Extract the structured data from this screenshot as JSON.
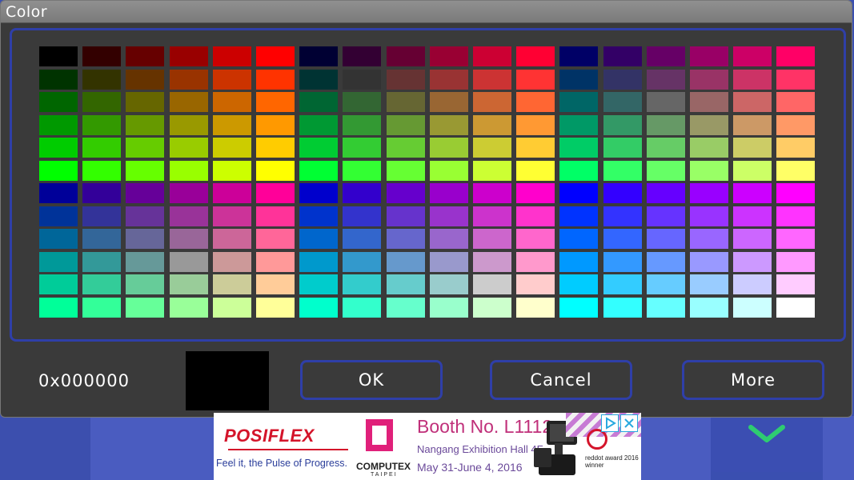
{
  "dialog": {
    "title": "Color",
    "hex_value": "0x000000",
    "selected_color": "#000000",
    "buttons": {
      "ok": "OK",
      "cancel": "Cancel",
      "more": "More"
    },
    "accent_color": "#2f3fa8"
  },
  "palette": {
    "rows": 12,
    "cols": 18
  },
  "ad": {
    "brand": "POSIFLEX",
    "slogan": "Feel it, the Pulse of Progress.",
    "event_logo": "COMPUTEX",
    "event_city": "TAIPEI",
    "booth": "Booth No. L1112",
    "hall": "Nangang Exhibition Hall 4F",
    "dates": "May 31-June 4, 2016",
    "award": "reddot award 2016 winner"
  },
  "background": {
    "icon": "chevron-down-icon"
  }
}
